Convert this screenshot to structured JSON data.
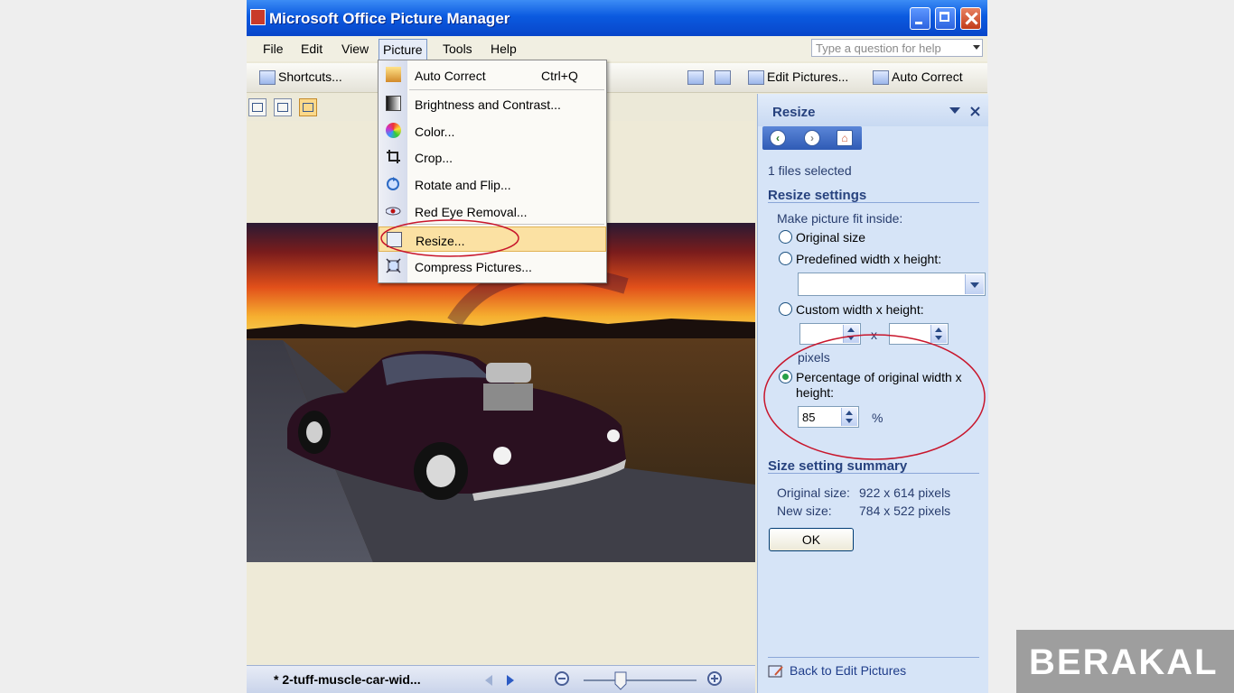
{
  "window": {
    "title": "Microsoft Office Picture Manager"
  },
  "menubar": {
    "items": [
      "File",
      "Edit",
      "View",
      "Picture",
      "Tools",
      "Help"
    ],
    "active": "Picture",
    "help_placeholder": "Type a question for help"
  },
  "toolbar": {
    "shortcuts_label": "Shortcuts...",
    "edit_pictures_label": "Edit Pictures...",
    "auto_correct_label": "Auto Correct"
  },
  "picture_menu": {
    "items": [
      {
        "label": "Auto Correct",
        "shortcut": "Ctrl+Q",
        "icon": "auto-correct-icon"
      },
      {
        "label": "Brightness and Contrast...",
        "icon": "brightness-icon"
      },
      {
        "label": "Color...",
        "icon": "color-wheel-icon"
      },
      {
        "label": "Crop...",
        "icon": "crop-icon"
      },
      {
        "label": "Rotate and Flip...",
        "icon": "rotate-icon"
      },
      {
        "label": "Red Eye Removal...",
        "icon": "red-eye-icon"
      },
      {
        "label": "Resize...",
        "icon": "resize-icon",
        "highlighted": true
      },
      {
        "label": "Compress Pictures...",
        "icon": "compress-icon"
      }
    ]
  },
  "status": {
    "filename": "* 2-tuff-muscle-car-wid..."
  },
  "task_pane": {
    "title": "Resize",
    "files_selected": "1 files selected",
    "settings_heading": "Resize settings",
    "fit_label": "Make picture fit inside:",
    "options": {
      "original": "Original size",
      "predefined": "Predefined width x height:",
      "custom": "Custom width x height:",
      "percentage": "Percentage of original width x height:"
    },
    "selected_option": "percentage",
    "custom_x_label": "x",
    "pixels_label": "pixels",
    "percent_value": "85",
    "percent_unit": "%",
    "summary_heading": "Size setting summary",
    "original_size_label": "Original size:",
    "original_size_value": "922 x 614 pixels",
    "new_size_label": "New size:",
    "new_size_value": "784 x 522 pixels",
    "ok_label": "OK",
    "back_link": "Back to Edit Pictures"
  },
  "watermark": {
    "text": "BERAKAL"
  },
  "colors": {
    "title_bar": "#0b5ae0",
    "pane_heading": "#27427e",
    "annotation": "#c8162c",
    "menu_highlight": "#fbe1a3"
  }
}
